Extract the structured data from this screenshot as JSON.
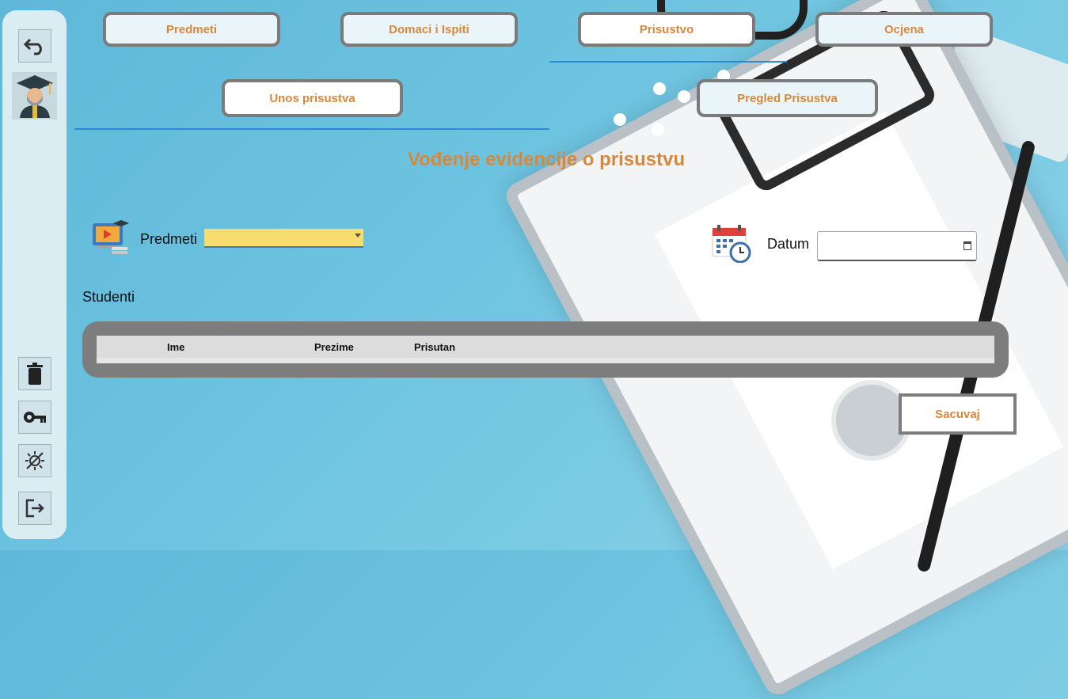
{
  "tabs": [
    {
      "label": "Predmeti",
      "active": false
    },
    {
      "label": "Domaci i Ispiti",
      "active": false
    },
    {
      "label": "Prisustvo",
      "active": true
    },
    {
      "label": "Ocjena",
      "active": false
    }
  ],
  "subtabs": [
    {
      "label": "Unos prisustva",
      "active": true
    },
    {
      "label": "Pregled Prisustva",
      "active": false
    }
  ],
  "page_title": "Vođenje evidencije o prisustvu",
  "form": {
    "subject_label": "Predmeti",
    "subject_value": "",
    "date_label": "Datum",
    "date_value": "",
    "students_label": "Studenti"
  },
  "table": {
    "columns": [
      "Ime",
      "Prezime",
      "Prisutan"
    ],
    "rows": []
  },
  "save_label": "Sacuvaj",
  "sidebar": {
    "icons": [
      "undo-icon",
      "avatar",
      "trash-icon",
      "key-icon",
      "theme-icon",
      "logout-icon"
    ]
  },
  "colors": {
    "accent": "#d6883b",
    "tab_border": "#7b7b7b",
    "underline": "#2a8ccf",
    "select_bg": "#f7dc6f"
  }
}
